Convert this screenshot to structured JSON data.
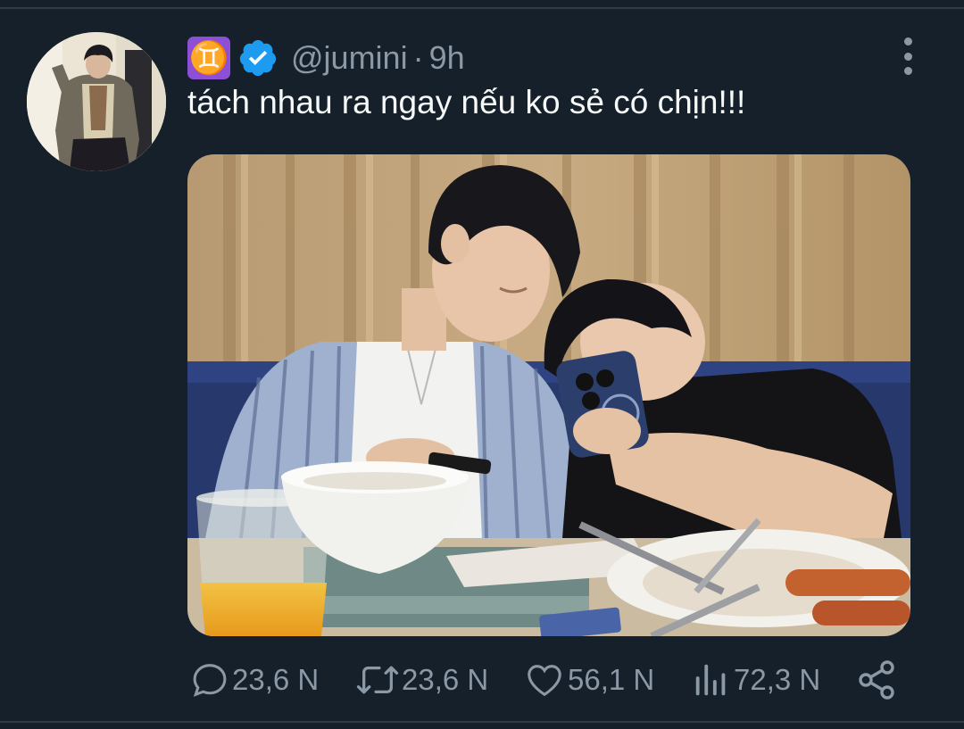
{
  "tweet": {
    "zodiac_emoji": "♊",
    "handle": "@jumini",
    "separator": "·",
    "time": "9h",
    "text": "tách nhau ra ngay nếu ko sẻ có chịn!!!"
  },
  "actions": {
    "replies": "23,6 N",
    "retweets": "23,6 N",
    "likes": "56,1 N",
    "views": "72,3 N"
  },
  "colors": {
    "background": "#15202b",
    "text": "#f7f9f9",
    "secondary": "#8b98a5",
    "verified": "#1d9bf0",
    "zodiac": "#8c4fd6"
  },
  "icons": [
    "avatar",
    "gemini-emoji",
    "verified-badge-icon",
    "more-icon",
    "reply-icon",
    "retweet-icon",
    "like-icon",
    "views-icon",
    "share-icon"
  ]
}
